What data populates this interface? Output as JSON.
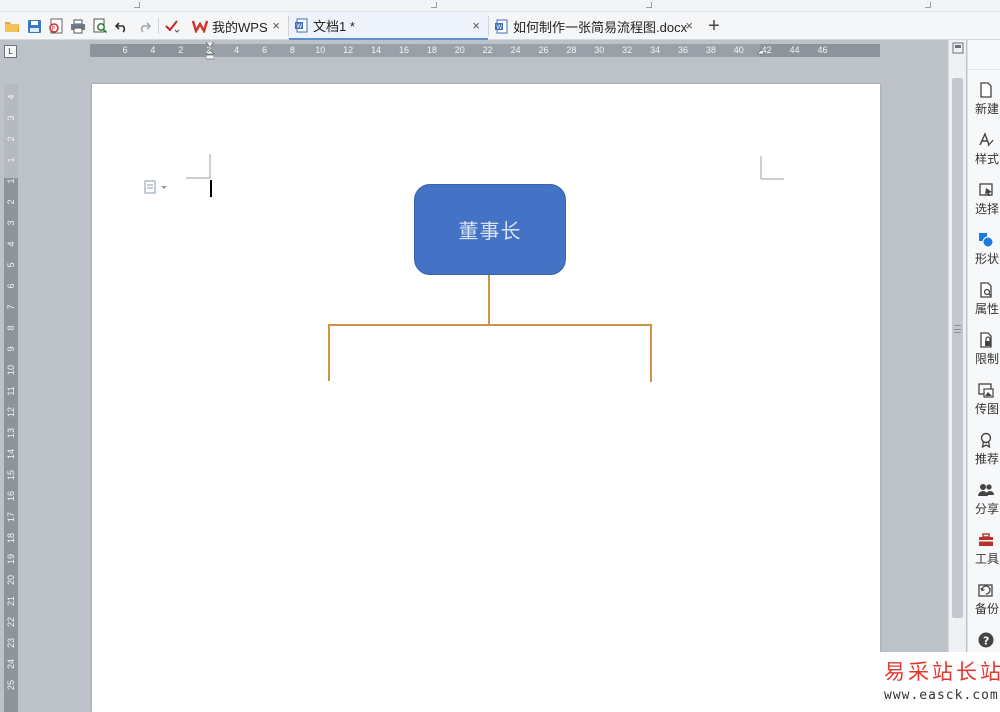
{
  "tabbar": {
    "tabs": [
      {
        "label": "我的WPS",
        "active": false
      },
      {
        "label": "文档1 *",
        "active": true
      },
      {
        "label": "如何制作一张简易流程图.docx",
        "active": false
      }
    ],
    "close_glyph": "×",
    "new_tab_glyph": "+"
  },
  "quick_access": [
    "open-folder-icon",
    "save-icon",
    "export-pdf-icon",
    "print-icon",
    "print-preview-icon",
    "undo-icon",
    "redo-icon",
    "customize-icon"
  ],
  "ruler": {
    "corner_label": "L",
    "h_numbers": [
      "6",
      "4",
      "2",
      "2",
      "4",
      "6",
      "8",
      "10",
      "12",
      "14",
      "16",
      "18",
      "20",
      "22",
      "24",
      "26",
      "28",
      "30",
      "32",
      "34",
      "36",
      "38",
      "40",
      "42",
      "44",
      "46"
    ],
    "v_numbers": [
      "4",
      "3",
      "2",
      "1",
      "1",
      "2",
      "3",
      "4",
      "5",
      "6",
      "7",
      "8",
      "9",
      "10",
      "11",
      "12",
      "13",
      "14",
      "15",
      "16",
      "17",
      "18",
      "19",
      "20",
      "21",
      "22",
      "23",
      "24",
      "25"
    ]
  },
  "document": {
    "shape_text": "董事长",
    "colors": {
      "shape_fill": "#4472C4",
      "shape_text": "#D8E3F5",
      "connector": "#D2914B"
    }
  },
  "sidebar": {
    "items": [
      {
        "label": "新建",
        "icon": "new-doc-icon"
      },
      {
        "label": "样式",
        "icon": "style-icon"
      },
      {
        "label": "选择",
        "icon": "select-icon"
      },
      {
        "label": "形状",
        "icon": "shape-icon"
      },
      {
        "label": "属性",
        "icon": "properties-icon"
      },
      {
        "label": "限制",
        "icon": "restrict-icon"
      },
      {
        "label": "传图",
        "icon": "upload-image-icon"
      },
      {
        "label": "推荐",
        "icon": "recommend-icon"
      },
      {
        "label": "分享",
        "icon": "share-icon"
      },
      {
        "label": "工具",
        "icon": "toolbox-icon"
      },
      {
        "label": "备份",
        "icon": "backup-icon"
      },
      {
        "label": "帮助",
        "icon": "help-icon"
      }
    ]
  },
  "watermark": {
    "title": "易采站长站",
    "url": "www.easck.com"
  }
}
